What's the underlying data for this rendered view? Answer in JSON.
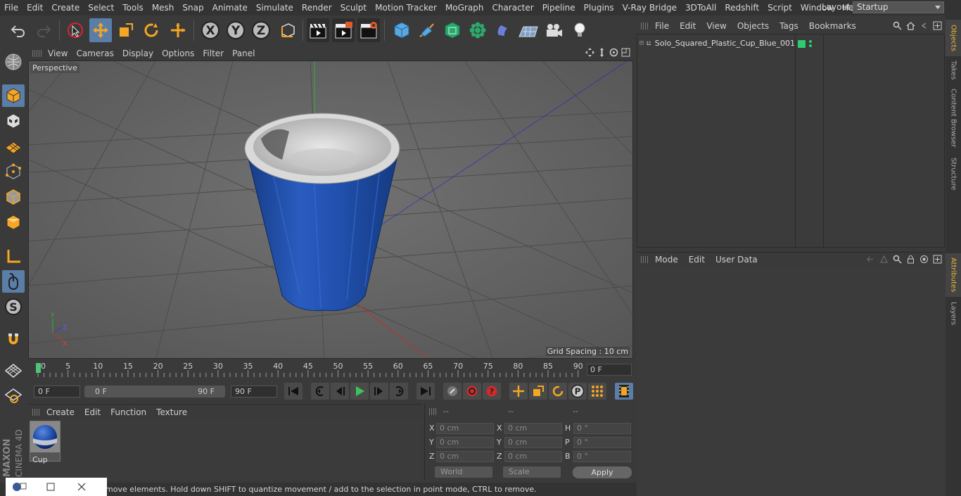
{
  "menubar": {
    "items": [
      "File",
      "Edit",
      "Create",
      "Select",
      "Tools",
      "Mesh",
      "Snap",
      "Animate",
      "Simulate",
      "Render",
      "Sculpt",
      "Motion Tracker",
      "MoGraph",
      "Character",
      "Pipeline",
      "Plugins",
      "V-Ray Bridge",
      "3DToAll",
      "Redshift",
      "Script",
      "Window",
      "Help"
    ],
    "layout_label": "Layout:",
    "layout_value": "Startup"
  },
  "viewport": {
    "menu": [
      "View",
      "Cameras",
      "Display",
      "Options",
      "Filter",
      "Panel"
    ],
    "camera_label": "Perspective",
    "grid_spacing": "Grid Spacing : 10 cm"
  },
  "timeline": {
    "ticks": [
      "0",
      "5",
      "10",
      "15",
      "20",
      "25",
      "30",
      "35",
      "40",
      "45",
      "50",
      "55",
      "60",
      "65",
      "70",
      "75",
      "80",
      "85",
      "90"
    ],
    "current_frame": "0 F"
  },
  "transport": {
    "start_field": "0 F",
    "range_start": "0 F",
    "range_end": "90 F",
    "end_field": "90 F"
  },
  "material_manager": {
    "menu": [
      "Create",
      "Edit",
      "Function",
      "Texture"
    ],
    "material_name": "Cup"
  },
  "coordinates": {
    "headers": [
      "--",
      "--",
      "--"
    ],
    "rows": [
      {
        "l1": "X",
        "v1": "0 cm",
        "l2": "X",
        "v2": "0 cm",
        "l3": "H",
        "v3": "0 °"
      },
      {
        "l1": "Y",
        "v1": "0 cm",
        "l2": "Y",
        "v2": "0 cm",
        "l3": "P",
        "v3": "0 °"
      },
      {
        "l1": "Z",
        "v1": "0 cm",
        "l2": "Z",
        "v2": "0 cm",
        "l3": "B",
        "v3": "0 °"
      }
    ],
    "mode_world": "World",
    "mode_scale": "Scale",
    "apply_label": "Apply"
  },
  "status": {
    "text": "move elements. Hold down SHIFT to quantize movement / add to the selection in point mode, CTRL to remove."
  },
  "object_manager": {
    "menu": [
      "File",
      "Edit",
      "View",
      "Objects",
      "Tags",
      "Bookmarks"
    ],
    "object_name": "Solo_Squared_Plastic_Cup_Blue_001"
  },
  "attribute_manager": {
    "menu": [
      "Mode",
      "Edit",
      "User Data"
    ]
  },
  "side_tabs": [
    "Objects",
    "Takes",
    "Content Browser",
    "Structure",
    "Attributes",
    "Layers"
  ],
  "brand": {
    "maxon": "MAXON",
    "cinema": "CINEMA 4D"
  },
  "colors": {
    "accent": "#5a7ea8",
    "cup_blue": "#1f4fa8",
    "tab_active": "#e8b53a"
  }
}
